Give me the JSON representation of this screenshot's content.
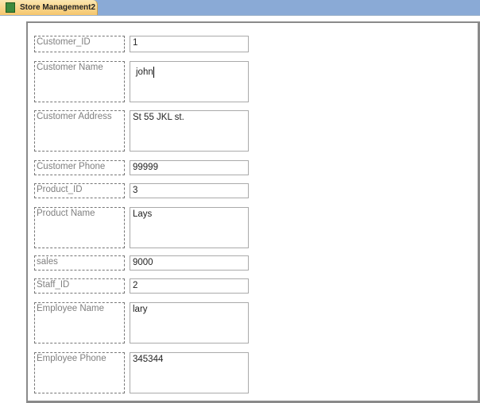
{
  "tab": {
    "title": "Store Management2",
    "icon": "form-icon"
  },
  "fields": [
    {
      "label": "Customer_ID",
      "value": "1"
    },
    {
      "label": "Customer Name",
      "value": "john"
    },
    {
      "label": "Customer Address",
      "value": "St 55 JKL st."
    },
    {
      "label": "Customer Phone",
      "value": "99999"
    },
    {
      "label": "Product_ID",
      "value": "3"
    },
    {
      "label": "Product Name",
      "value": "Lays"
    },
    {
      "label": "sales",
      "value": "9000"
    },
    {
      "label": "Staff_ID",
      "value": "2"
    },
    {
      "label": "Employee Name",
      "value": "lary"
    },
    {
      "label": "Employee Phone",
      "value": "345344"
    }
  ]
}
